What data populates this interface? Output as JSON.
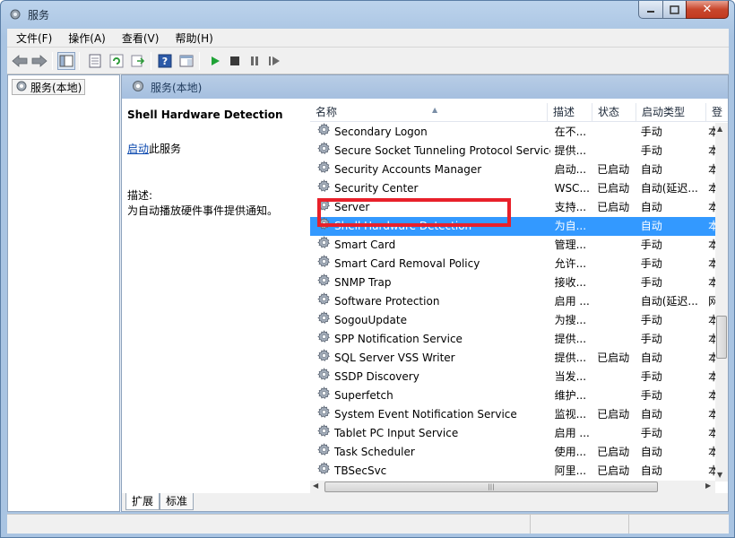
{
  "window": {
    "title": "服务"
  },
  "menubar": {
    "items": [
      "文件(F)",
      "操作(A)",
      "查看(V)",
      "帮助(H)"
    ]
  },
  "tree": {
    "root_label": "服务(本地)"
  },
  "pane": {
    "header_label": "服务(本地)"
  },
  "details": {
    "service_name": "Shell Hardware Detection",
    "start_link": "启动",
    "start_suffix": "此服务",
    "desc_label": "描述:",
    "desc_text": "为自动播放硬件事件提供通知。"
  },
  "list": {
    "columns": [
      "名称",
      "描述",
      "状态",
      "启动类型",
      "登"
    ],
    "rows": [
      {
        "name": "Secondary Logon",
        "desc": "在不...",
        "state": "",
        "start": "手动",
        "extra": "本"
      },
      {
        "name": "Secure Socket Tunneling Protocol Service",
        "desc": "提供...",
        "state": "",
        "start": "手动",
        "extra": "本"
      },
      {
        "name": "Security Accounts Manager",
        "desc": "启动...",
        "state": "已启动",
        "start": "自动",
        "extra": "本"
      },
      {
        "name": "Security Center",
        "desc": "WSC...",
        "state": "已启动",
        "start": "自动(延迟...",
        "extra": "本"
      },
      {
        "name": "Server",
        "desc": "支持...",
        "state": "已启动",
        "start": "自动",
        "extra": "本"
      },
      {
        "name": "Shell Hardware Detection",
        "desc": "为自...",
        "state": "",
        "start": "自动",
        "extra": "本"
      },
      {
        "name": "Smart Card",
        "desc": "管理...",
        "state": "",
        "start": "手动",
        "extra": "本"
      },
      {
        "name": "Smart Card Removal Policy",
        "desc": "允许...",
        "state": "",
        "start": "手动",
        "extra": "本"
      },
      {
        "name": "SNMP Trap",
        "desc": "接收...",
        "state": "",
        "start": "手动",
        "extra": "本"
      },
      {
        "name": "Software Protection",
        "desc": "启用 ...",
        "state": "",
        "start": "自动(延迟...",
        "extra": "网"
      },
      {
        "name": "SogouUpdate",
        "desc": "为搜...",
        "state": "",
        "start": "手动",
        "extra": "本"
      },
      {
        "name": "SPP Notification Service",
        "desc": "提供...",
        "state": "",
        "start": "手动",
        "extra": "本"
      },
      {
        "name": "SQL Server VSS Writer",
        "desc": "提供...",
        "state": "已启动",
        "start": "自动",
        "extra": "本"
      },
      {
        "name": "SSDP Discovery",
        "desc": "当发...",
        "state": "",
        "start": "手动",
        "extra": "本"
      },
      {
        "name": "Superfetch",
        "desc": "维护...",
        "state": "",
        "start": "手动",
        "extra": "本"
      },
      {
        "name": "System Event Notification Service",
        "desc": "监视...",
        "state": "已启动",
        "start": "自动",
        "extra": "本"
      },
      {
        "name": "Tablet PC Input Service",
        "desc": "启用 ...",
        "state": "",
        "start": "手动",
        "extra": "本"
      },
      {
        "name": "Task Scheduler",
        "desc": "使用...",
        "state": "已启动",
        "start": "自动",
        "extra": "本"
      },
      {
        "name": "TBSecSvc",
        "desc": "阿里...",
        "state": "已启动",
        "start": "自动",
        "extra": "本"
      }
    ],
    "selected_index": 5
  },
  "tabs": {
    "items": [
      "扩展",
      "标准"
    ]
  },
  "colors": {
    "selection": "#3399ff",
    "highlight_box": "#e8202a",
    "link": "#0645ad"
  },
  "icons": [
    "services-icon",
    "back-arrow-icon",
    "forward-arrow-icon",
    "console-tree-icon",
    "properties-icon",
    "refresh-icon",
    "export-icon",
    "help-icon",
    "panel-icon",
    "play-icon",
    "stop-icon",
    "pause-icon",
    "restart-icon",
    "gear-icon"
  ]
}
